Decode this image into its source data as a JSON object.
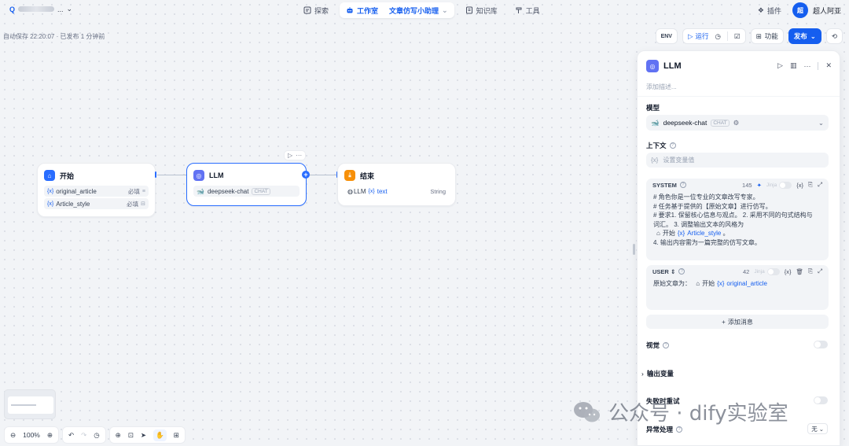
{
  "topnav": {
    "brand_prefix": "Q",
    "brand_suffix": "...",
    "items": [
      {
        "label": "探索"
      },
      {
        "label": "工作室",
        "sub": "文章仿写小助理"
      },
      {
        "label": "知识库"
      },
      {
        "label": "工具"
      }
    ],
    "plugin": "插件",
    "avatar_initial": "超",
    "username": "超人阿亚"
  },
  "autosave": "自动保存 22:20:07 · 已发布 1 分钟前",
  "workflow_toolbar": {
    "run": "运行",
    "features": "功能",
    "publish": "发布"
  },
  "nodes": {
    "start": {
      "title": "开始",
      "vars": [
        {
          "name": "original_article",
          "required": "必填"
        },
        {
          "name": "Article_style",
          "required": "必填"
        }
      ]
    },
    "llm": {
      "title": "LLM",
      "model": "deepseek-chat",
      "badge": "CHAT"
    },
    "end": {
      "title": "结束",
      "output_source": "LLM",
      "output_var": "text",
      "output_type": "String"
    }
  },
  "zoom": "100%",
  "panel": {
    "title": "LLM",
    "desc_placeholder": "添加描述...",
    "model_label": "模型",
    "model_name": "deepseek-chat",
    "model_badge": "CHAT",
    "context_label": "上下文",
    "context_placeholder": "设置变量值",
    "system": {
      "role": "SYSTEM",
      "count": "145",
      "jinja": "Jinja",
      "lines": [
        "# 角色你是一位专业的文章改写专家。",
        "# 任务基于提供的【原始文章】进行仿写。",
        "# 要求1. 保留核心信息与观点。 2. 采用不同的句式结构与",
        "词汇。 3. 调整输出文本的风格为"
      ],
      "ref_node": "开始",
      "ref_var": "Article_style",
      "ref_suffix": "。",
      "last_line": "4. 输出内容需为一篇完整的仿写文章。"
    },
    "user": {
      "role": "USER",
      "count": "42",
      "jinja": "Jinja",
      "prefix": "原始文章为：",
      "ref_node": "开始",
      "ref_var": "original_article"
    },
    "add_message": "添加消息",
    "vision_label": "视觉",
    "output_vars_label": "输出变量",
    "retry_label": "失败时重试",
    "error_label": "异常处理",
    "error_value": "无"
  },
  "watermark": "公众号 · dify实验室",
  "colors": {
    "accent": "#155eef",
    "start_icon": "#296dff",
    "llm_icon": "#6172f3",
    "end_icon": "#f79009"
  }
}
